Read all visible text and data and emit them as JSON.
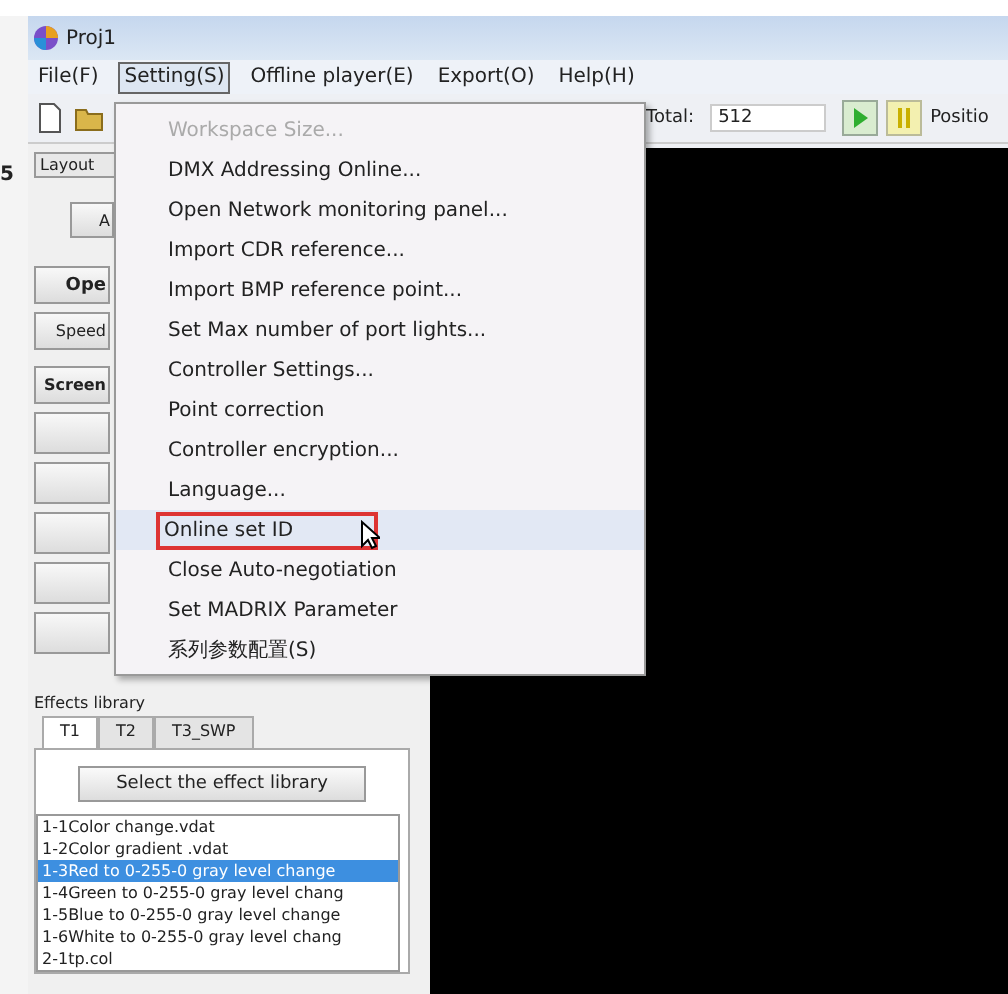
{
  "edge_fragment": "5",
  "window": {
    "title": "Proj1"
  },
  "menu_bar": [
    {
      "label": "File(F)",
      "selected": false
    },
    {
      "label": "Setting(S)",
      "selected": true
    },
    {
      "label": "Offline player(E)",
      "selected": false
    },
    {
      "label": "Export(O)",
      "selected": false
    },
    {
      "label": "Help(H)",
      "selected": false
    }
  ],
  "toolbar": {
    "total_label": "Total:",
    "total_value": "512",
    "position_label": "Positio"
  },
  "left_panel": {
    "layout_tab": "Layout",
    "buttons": [
      {
        "label": "A",
        "kind": "small"
      },
      {
        "label": "Ope",
        "kind": "bold"
      },
      {
        "label": "Speed",
        "kind": "plain"
      },
      {
        "label": "Screen",
        "kind": "tab"
      },
      {
        "kind": "blank"
      },
      {
        "kind": "blank"
      },
      {
        "kind": "blank"
      },
      {
        "kind": "blank"
      },
      {
        "kind": "blank"
      }
    ]
  },
  "effects_library": {
    "title": "Effects library",
    "tabs": [
      {
        "label": "T1",
        "selected": true
      },
      {
        "label": "T2",
        "selected": false
      },
      {
        "label": "T3_SWP",
        "selected": false
      }
    ],
    "select_button": "Select the effect library",
    "items": [
      {
        "label": "1-1Color change.vdat",
        "selected": false
      },
      {
        "label": "1-2Color gradient .vdat",
        "selected": false
      },
      {
        "label": "1-3Red to 0-255-0 gray level change",
        "selected": true
      },
      {
        "label": "1-4Green to 0-255-0 gray level chang",
        "selected": false
      },
      {
        "label": "1-5Blue to 0-255-0 gray level change",
        "selected": false
      },
      {
        "label": "1-6White to 0-255-0 gray level chang",
        "selected": false
      },
      {
        "label": "2-1tp.col",
        "selected": false
      }
    ]
  },
  "setting_menu": [
    {
      "label": "Workspace Size...",
      "disabled": true,
      "highlighted": false
    },
    {
      "label": "DMX Addressing Online...",
      "disabled": false,
      "highlighted": false
    },
    {
      "label": "Open Network monitoring panel...",
      "disabled": false,
      "highlighted": false
    },
    {
      "label": "Import CDR reference...",
      "disabled": false,
      "highlighted": false
    },
    {
      "label": "Import BMP reference point...",
      "disabled": false,
      "highlighted": false
    },
    {
      "label": "Set Max number of port lights...",
      "disabled": false,
      "highlighted": false
    },
    {
      "label": "Controller Settings...",
      "disabled": false,
      "highlighted": false
    },
    {
      "label": "Point correction",
      "disabled": false,
      "highlighted": false
    },
    {
      "label": "Controller encryption...",
      "disabled": false,
      "highlighted": false
    },
    {
      "label": "Language...",
      "disabled": false,
      "highlighted": false
    },
    {
      "label": "Online set ID",
      "disabled": false,
      "highlighted": true
    },
    {
      "label": "Close Auto-negotiation",
      "disabled": false,
      "highlighted": false
    },
    {
      "label": "Set MADRIX Parameter",
      "disabled": false,
      "highlighted": false
    },
    {
      "label": "系列参数配置(S)",
      "disabled": false,
      "highlighted": false
    }
  ]
}
